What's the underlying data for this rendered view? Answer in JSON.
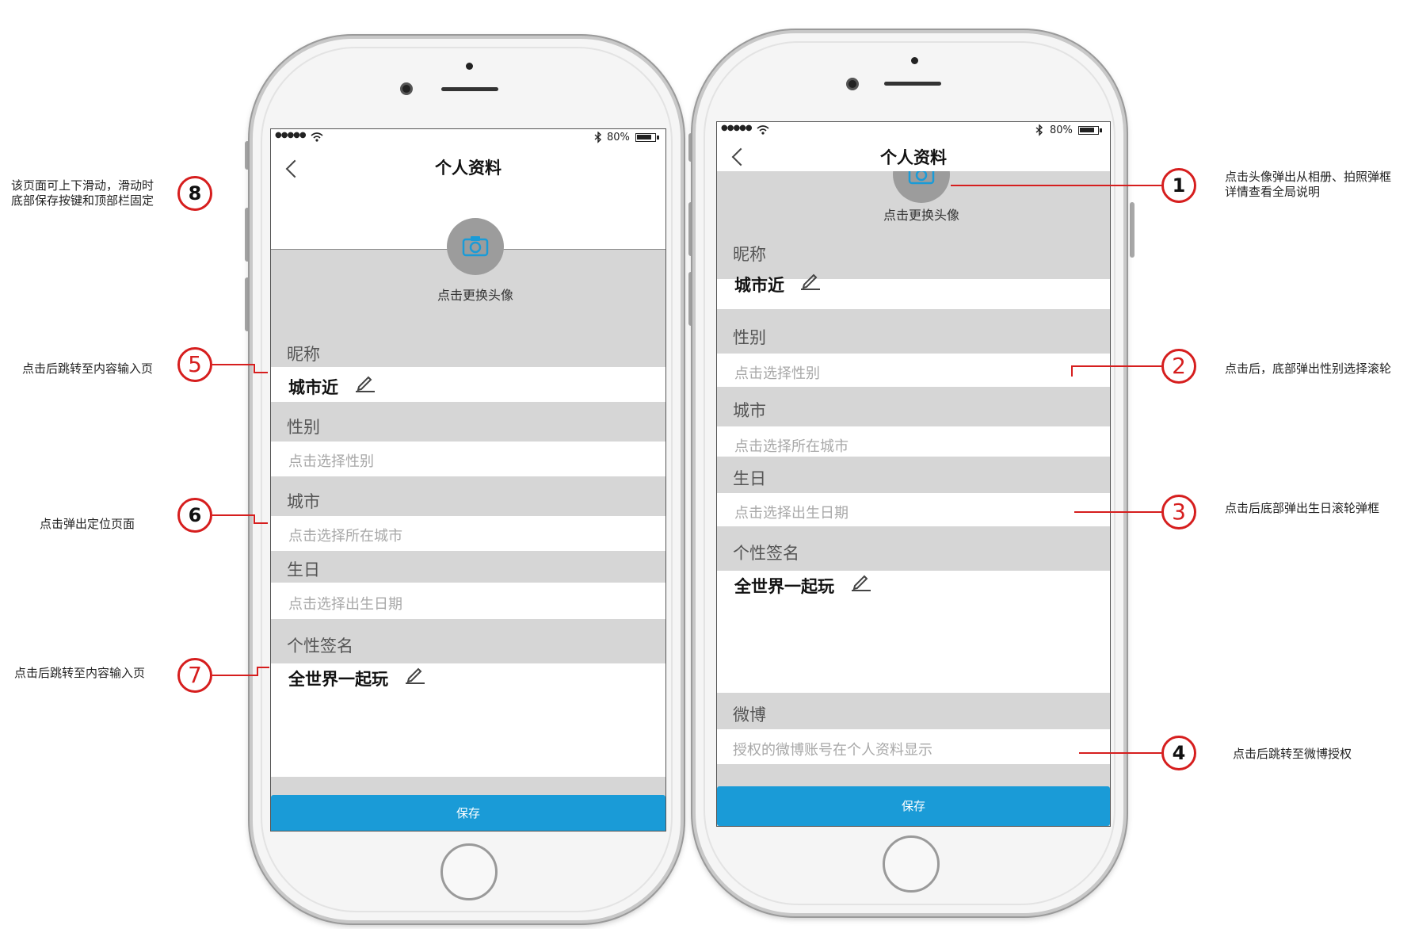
{
  "colors": {
    "accent": "#1a9bd7",
    "annotation": "#d61e1e",
    "band": "#d6d6d6"
  },
  "icons": {
    "back": "chevron-left-icon",
    "bluetooth": "bluetooth-icon",
    "battery": "battery-icon",
    "camera": "camera-icon",
    "pencil": "pencil-icon",
    "wifi": "wifi-icon"
  },
  "phone_left": {
    "status": {
      "signal": "●●●●●",
      "battery": "80%"
    },
    "title": "个人资料",
    "avatar_text": "点击更换头像",
    "nickname_label": "昵称",
    "nickname_value": "城市近",
    "gender_label": "性别",
    "gender_placeholder": "点击选择性别",
    "city_label": "城市",
    "city_placeholder": "点击选择所在城市",
    "birthday_label": "生日",
    "birthday_placeholder": "点击选择出生日期",
    "signature_label": "个性签名",
    "signature_value": "全世界一起玩",
    "save_label": "保存"
  },
  "phone_right": {
    "status": {
      "signal": "●●●●●",
      "battery": "80%"
    },
    "title": "个人资料",
    "avatar_text": "点击更换头像",
    "nickname_label": "昵称",
    "nickname_value": "城市近",
    "gender_label": "性别",
    "gender_placeholder": "点击选择性别",
    "city_label": "城市",
    "city_placeholder": "点击选择所在城市",
    "birthday_label": "生日",
    "birthday_placeholder": "点击选择出生日期",
    "signature_label": "个性签名",
    "signature_value": "全世界一起玩",
    "weibo_label": "微博",
    "weibo_placeholder": "授权的微博账号在个人资料显示",
    "save_label": "保存"
  },
  "annotations": {
    "a1": {
      "num": "1",
      "text": "点击头像弹出从相册、拍照弹框\n详情查看全局说明"
    },
    "a2": {
      "num": "2",
      "text": "点击后，底部弹出性别选择滚轮"
    },
    "a3": {
      "num": "3",
      "text": "点击后底部弹出生日滚轮弹框"
    },
    "a4": {
      "num": "4",
      "text": "点击后跳转至微博授权"
    },
    "a5": {
      "num": "5",
      "text": "点击后跳转至内容输入页"
    },
    "a6": {
      "num": "6",
      "text": "点击弹出定位页面"
    },
    "a7": {
      "num": "7",
      "text": "点击后跳转至内容输入页"
    },
    "a8": {
      "num": "8",
      "text": "该页面可上下滑动，滑动时\n底部保存按键和顶部栏固定"
    }
  }
}
